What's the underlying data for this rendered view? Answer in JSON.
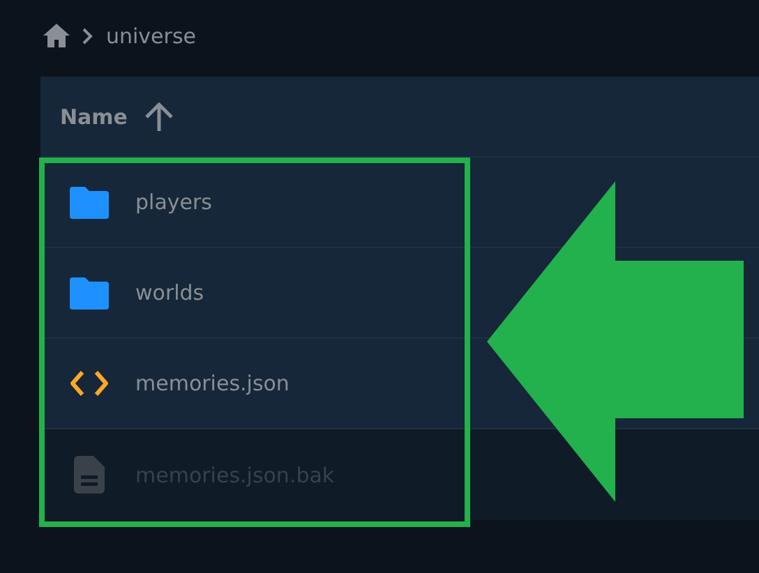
{
  "breadcrumb": {
    "items": [
      "universe"
    ]
  },
  "table": {
    "columns": [
      {
        "label": "Name",
        "sort_ascending": true
      }
    ],
    "rows": [
      {
        "name": "players",
        "kind": "folder",
        "disabled": false
      },
      {
        "name": "worlds",
        "kind": "folder",
        "disabled": false
      },
      {
        "name": "memories.json",
        "kind": "code",
        "disabled": false
      },
      {
        "name": "memories.json.bak",
        "kind": "file",
        "disabled": true
      }
    ]
  }
}
